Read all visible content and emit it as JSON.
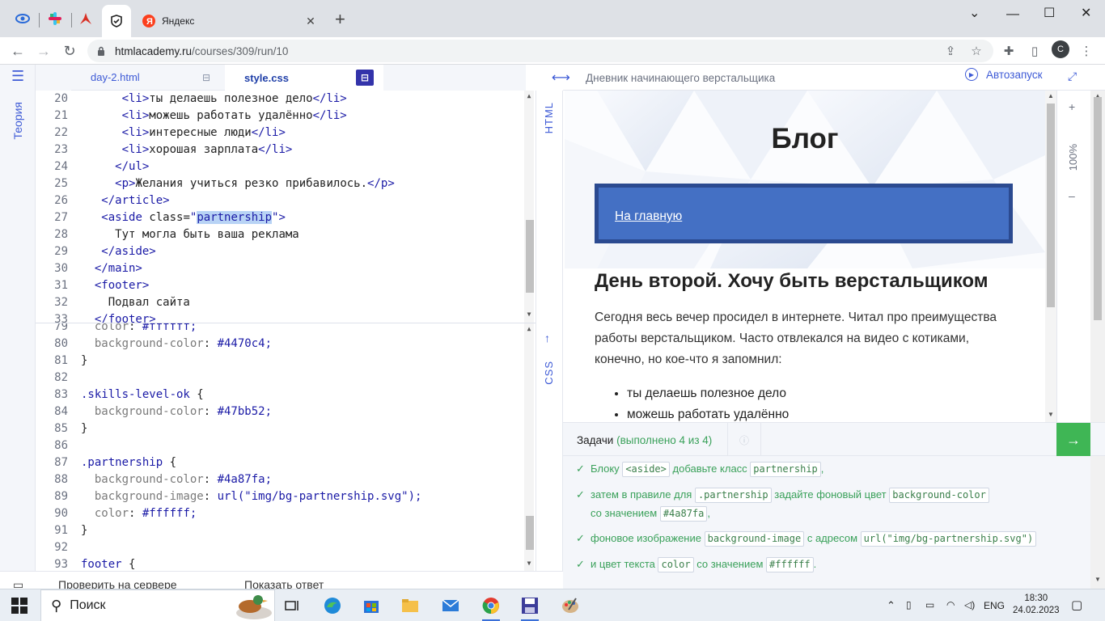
{
  "browser": {
    "pinned_tabs": [
      "htmlacademy-favicon",
      "slack-favicon",
      "yandex-services-favicon",
      "htmlacademy-active-favicon"
    ],
    "active_tab_title": "Яндекс",
    "url_host": "htmlacademy.ru",
    "url_path": "/courses/309/run/10",
    "profile_initial": "C"
  },
  "sidebar": {
    "theory_label": "Теория"
  },
  "file_tabs": {
    "html_tab": "day-2.html",
    "css_tab": "style.css"
  },
  "panel_labels": {
    "html": "HTML",
    "css": "CSS"
  },
  "html_lines": [
    {
      "n": "20",
      "indent": "      "
    },
    {
      "n": "21",
      "indent": "      "
    },
    {
      "n": "22",
      "indent": "      "
    },
    {
      "n": "23",
      "indent": "      "
    },
    {
      "n": "24",
      "indent": "     "
    },
    {
      "n": "25",
      "indent": "     "
    },
    {
      "n": "26",
      "indent": "   "
    },
    {
      "n": "27",
      "indent": "   "
    },
    {
      "n": "28",
      "indent": "     "
    },
    {
      "n": "29",
      "indent": "   "
    },
    {
      "n": "30",
      "indent": "  "
    },
    {
      "n": "31",
      "indent": "  "
    },
    {
      "n": "32",
      "indent": "    "
    },
    {
      "n": "33",
      "indent": "  "
    }
  ],
  "html_code": {
    "l20_text": "ты делаешь полезное дело",
    "l21_text": "можешь работать удалённо",
    "l22_text": "интересные люди",
    "l23_text": "хорошая зарплата",
    "l25_text": "Желания учиться резко прибавилось.",
    "l27_class_value": "partnership",
    "l28_text": "Тут могла быть ваша реклама",
    "l32_text": "Подвал сайта"
  },
  "css_lines": {
    "n79": "79",
    "n80": "80",
    "n81": "81",
    "n82": "82",
    "n83": "83",
    "n84": "84",
    "n85": "85",
    "n86": "86",
    "n87": "87",
    "n88": "88",
    "n89": "89",
    "n90": "90",
    "n91": "91",
    "n92": "92",
    "n93": "93",
    "l79_prop": "color",
    "l79_val": "#ffffff;",
    "l80_prop": "background-color",
    "l80_val": "#4470c4;",
    "l83_sel": ".skills-level-ok",
    "l84_prop": "background-color",
    "l84_val": "#47bb52;",
    "l87_sel": ".partnership",
    "l88_prop": "background-color",
    "l88_val": "#4a87fa;",
    "l89_prop": "background-image",
    "l89_val": "url(\"img/bg-partnership.svg\");",
    "l90_prop": "color",
    "l90_val": "#ffffff;",
    "l93_sel": "footer"
  },
  "bottom_actions": {
    "check": "Проверить на сервере",
    "show": "Показать ответ"
  },
  "preview": {
    "window_title": "Дневник начинающего верстальщика",
    "autorun": "Автозапуск",
    "zoom": "100%",
    "blog_title": "Блог",
    "nav_link": "На главную",
    "day_title": "День второй. Хочу быть верстальщиком",
    "day_text": "Сегодня весь вечер просидел в интернете. Читал про преимущества работы верстальщиком. Часто отвлекался на видео с котиками, конечно, но кое-что я запомнил:",
    "list": [
      "ты делаешь полезное дело",
      "можешь работать удалённо"
    ]
  },
  "tasks": {
    "title": "Задачи",
    "count": "(выполнено 4 из 4)",
    "t1_a": "Блоку",
    "t1_kw1": "<aside>",
    "t1_b": "добавьте класс",
    "t1_kw2": "partnership",
    "t1_c": ",",
    "t2_a": "затем в правиле для",
    "t2_kw1": ".partnership",
    "t2_b": "задайте фоновый цвет",
    "t2_kw2": "background-color",
    "t2_c": "со значением",
    "t2_kw3": "#4a87fa",
    "t2_d": ",",
    "t3_a": "фоновое изображение",
    "t3_kw1": "background-image",
    "t3_b": "с адресом",
    "t3_kw2": "url(\"img/bg-partnership.svg\")",
    "t4_a": "и цвет текста",
    "t4_kw1": "color",
    "t4_b": "со значением",
    "t4_kw2": "#ffffff",
    "t4_c": "."
  },
  "taskbar": {
    "search_label": "Поиск",
    "lang": "ENG",
    "time": "18:30",
    "date": "24.02.2023"
  },
  "colors": {
    "accent": "#3d5ad6",
    "nav_box": "#4470c4",
    "nav_border": "#2b4a90",
    "success": "#3fb655"
  }
}
